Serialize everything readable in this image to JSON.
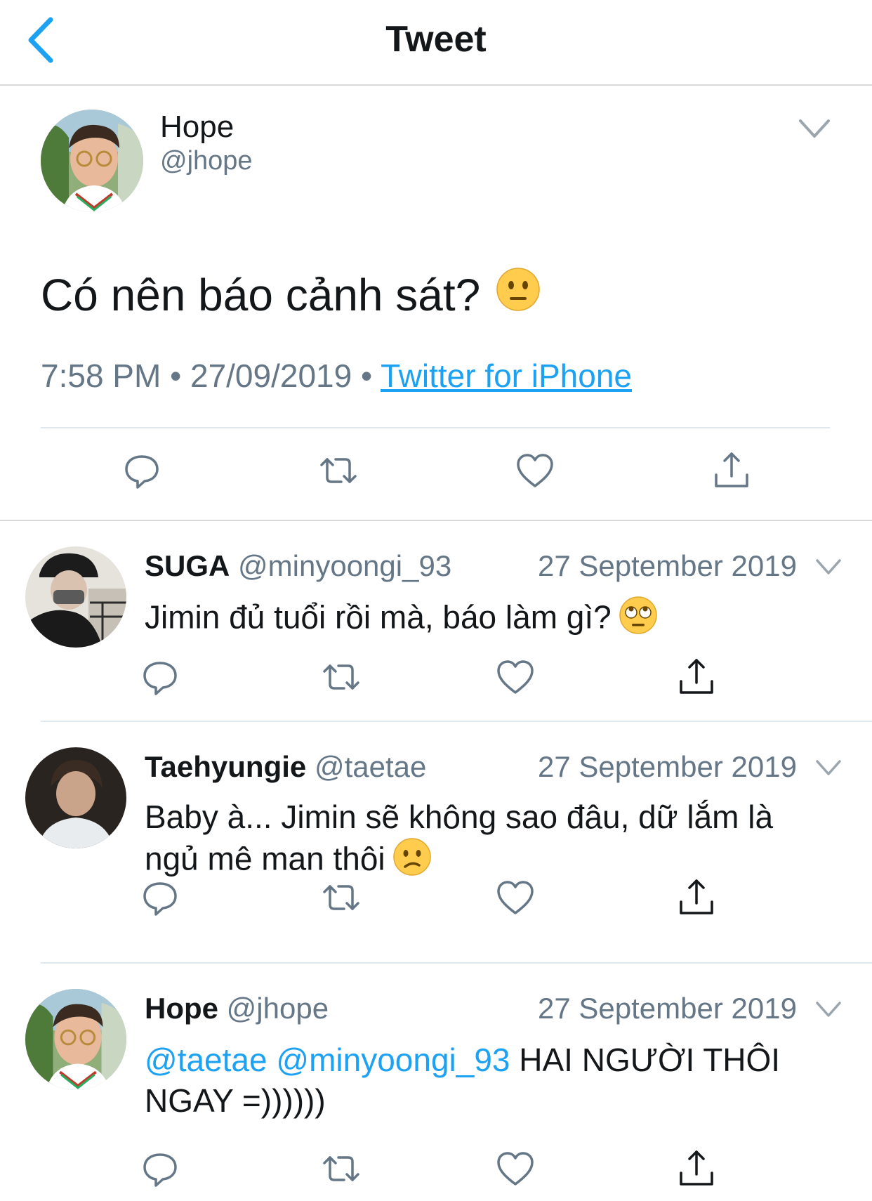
{
  "header": {
    "title": "Tweet",
    "back_icon": "chevron-left-icon"
  },
  "colors": {
    "accent": "#1da1f2",
    "secondary_text": "#657786",
    "divider": "#e1e8ed"
  },
  "main_tweet": {
    "name": "Hope",
    "handle": "@jhope",
    "text": "Có nên báo cảnh sát?",
    "emoji": "neutral-face-emoji",
    "time": "7:58 PM",
    "date": "27/09/2019",
    "separator": "•",
    "source": "Twitter for iPhone"
  },
  "replies": [
    {
      "name": "SUGA",
      "handle": "@minyoongi_93",
      "date": "27 September 2019",
      "text": "Jimin đủ tuổi rồi mà, báo làm gì?",
      "emoji": "face-with-rolling-eyes-emoji"
    },
    {
      "name": "Taehyungie",
      "handle": "@taetae",
      "date": "27 September 2019",
      "text": "Baby à... Jimin sẽ không sao đâu, dữ lắm là ngủ mê man thôi",
      "emoji": "confused-face-emoji"
    },
    {
      "name": "Hope",
      "handle": "@jhope",
      "date": "27 September 2019",
      "mentions": [
        "@taetae",
        "@minyoongi_93"
      ],
      "text": "HAI NGƯỜI THÔI NGAY =))))))"
    }
  ]
}
